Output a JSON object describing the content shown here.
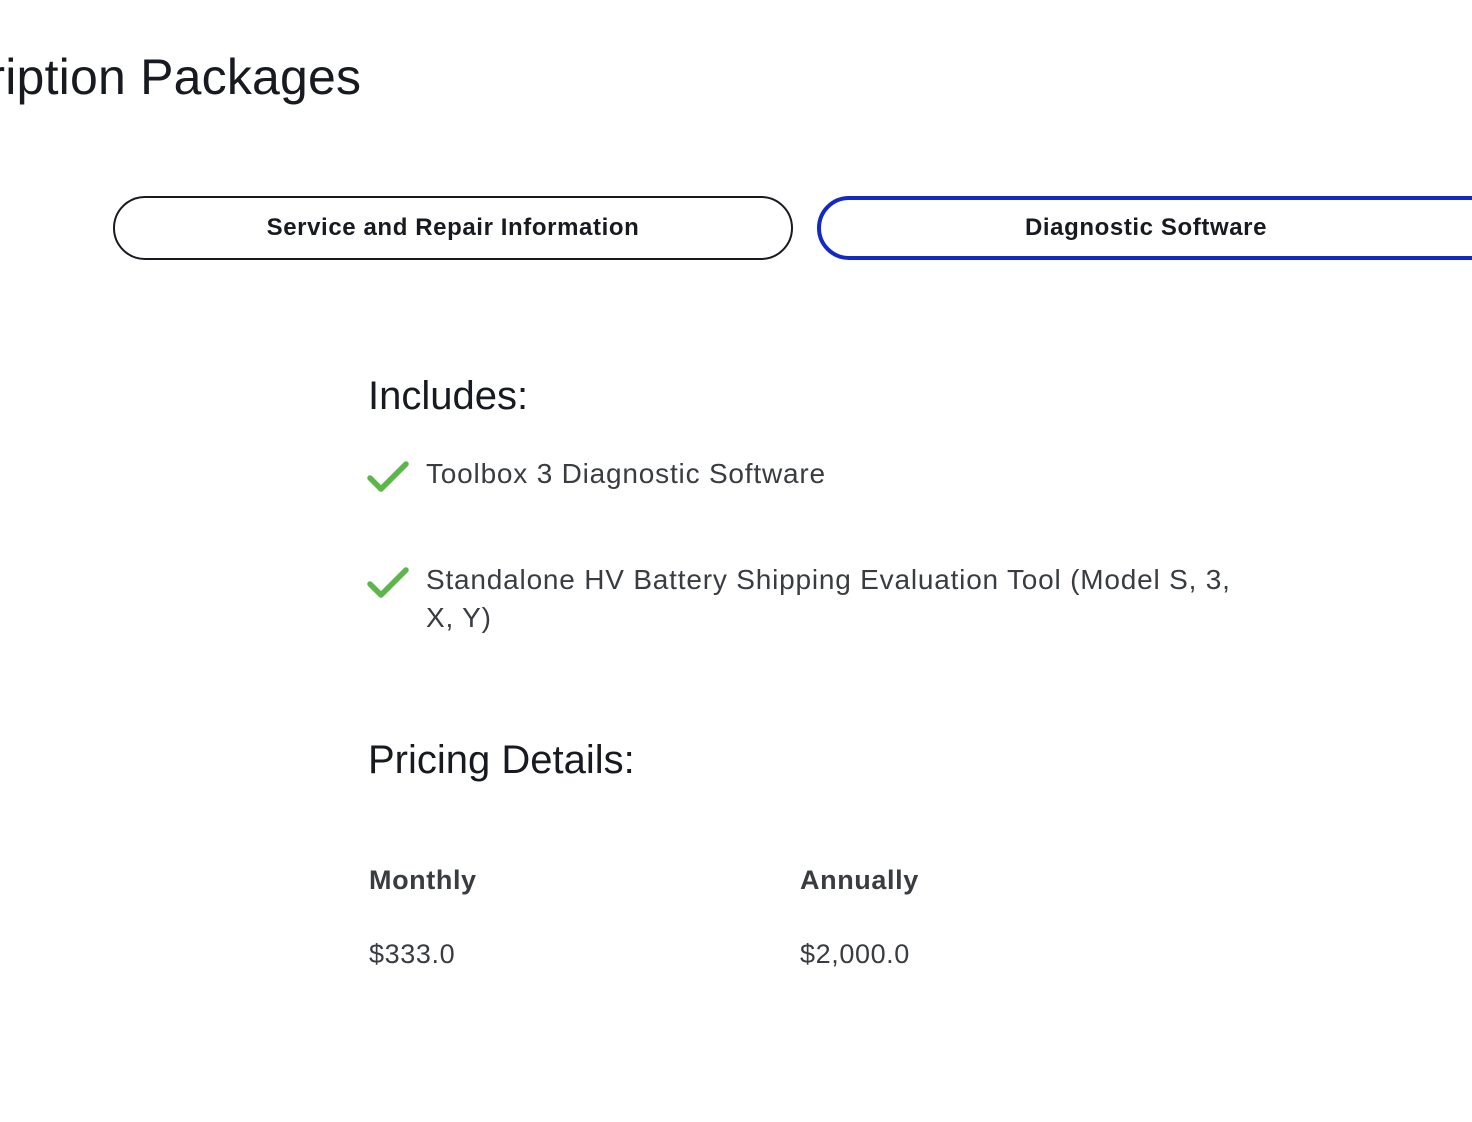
{
  "page": {
    "title": "scription Packages"
  },
  "tabs": [
    {
      "label": "Service and Repair Information",
      "selected": false
    },
    {
      "label": "Diagnostic Software",
      "selected": true
    }
  ],
  "includes": {
    "heading": "Includes:",
    "items": [
      {
        "text": "Toolbox 3 Diagnostic Software",
        "icon": "check-icon"
      },
      {
        "text": "Standalone HV Battery Shipping Evaluation Tool (Model S, 3, X, Y)",
        "icon": "check-icon"
      }
    ]
  },
  "pricing": {
    "heading": "Pricing Details:",
    "columns": [
      {
        "label": "Monthly",
        "value": "$333.0"
      },
      {
        "label": "Annually",
        "value": "$2,000.0"
      }
    ]
  },
  "colors": {
    "selected_tab_border": "#1229c6",
    "check_green": "#5cb64a",
    "text_dark": "#171a20",
    "text_body": "#393c41"
  }
}
